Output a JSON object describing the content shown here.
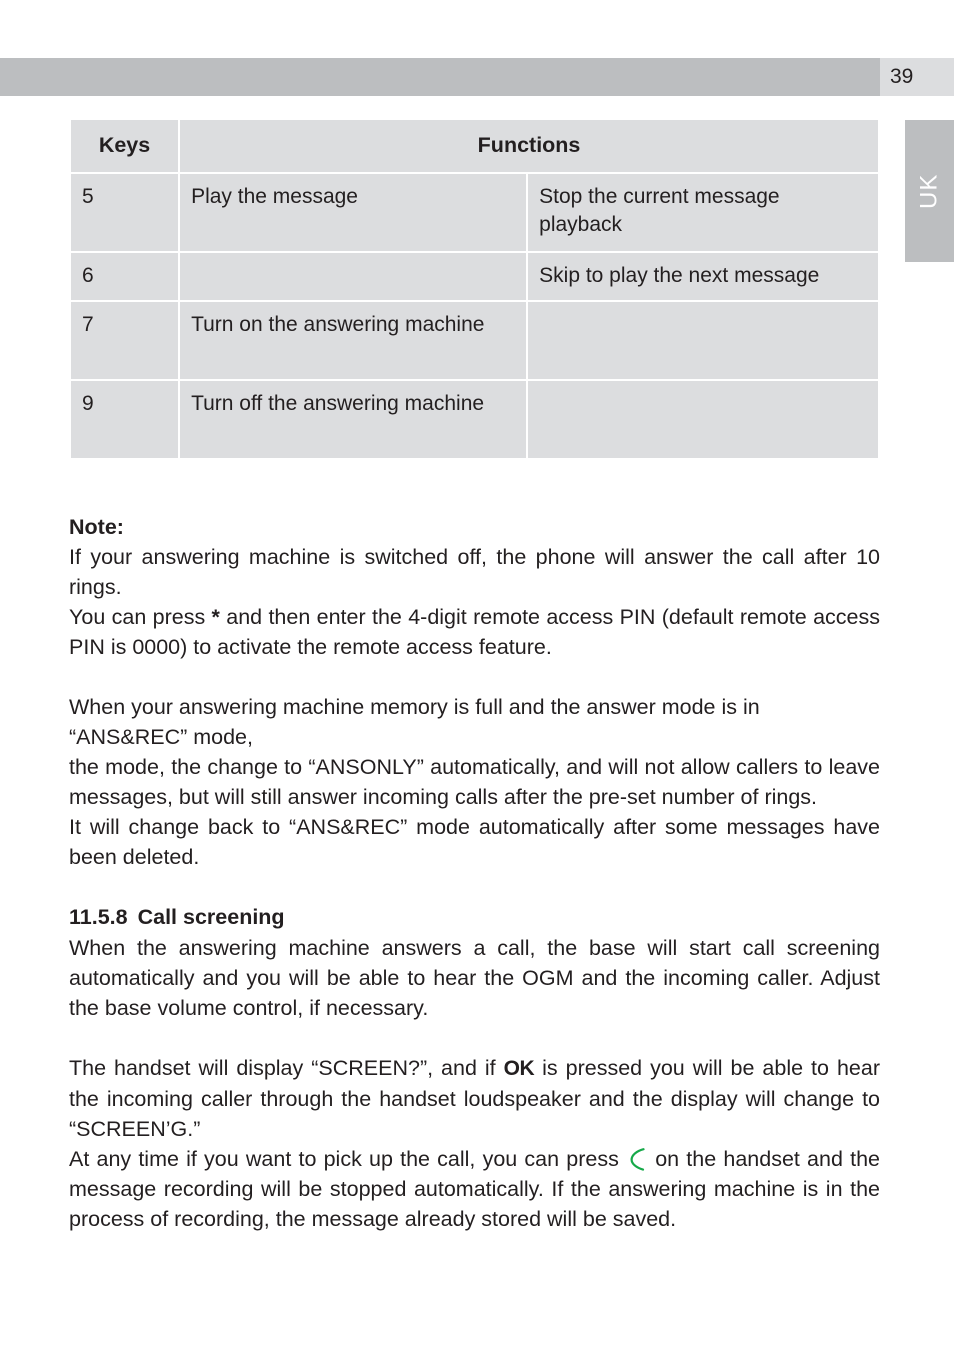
{
  "header": {
    "page_number": "39"
  },
  "side_tab": {
    "label": "UK"
  },
  "table": {
    "headers": {
      "keys": "Keys",
      "functions": "Functions"
    },
    "rows": [
      {
        "key": "5",
        "fn1": "Play the message",
        "fn2": "Stop the current message playback"
      },
      {
        "key": "6",
        "fn1": "",
        "fn2": "Skip to play the next message"
      },
      {
        "key": "7",
        "fn1": "Turn on the answering machine",
        "fn2": ""
      },
      {
        "key": "9",
        "fn1": "Turn off the answering machine",
        "fn2": ""
      }
    ]
  },
  "note": {
    "title": "Note:",
    "p1": "If your answering machine is switched off, the phone will answer the call after 10 rings.",
    "p2_part1": "You can press ",
    "p2_star": "*",
    "p2_part2": " and then enter the 4-digit remote access PIN (default remote access PIN is 0000) to activate the remote access feature.",
    "p3": "When your answering machine memory is full and the answer mode is in “ANS&REC” mode,",
    "p4": "the mode, the change to “ANSONLY” automatically, and will not allow callers to leave messages, but will still answer incoming calls after the pre-set number of rings.",
    "p5": "It will change back to “ANS&REC” mode automatically after some messages have been deleted."
  },
  "section": {
    "number": "11.5.8",
    "title": "Call screening",
    "p1": "When the answering machine answers a call, the base will start call screening automatically and you will be able to hear the OGM and the incoming caller. Adjust the base volume control, if necessary.",
    "p2_part1": "The handset will display “SCREEN?”, and if ",
    "p2_ok": "OK",
    "p2_part2": " is pressed you will be able to hear the incoming caller through the handset loudspeaker and the display will change to “SCREEN’G.”",
    "p3_part1": "At any time if you want to pick up the call, you can press ",
    "p3_icon": "phone-pickup-icon",
    "p3_part2": " on the handset and the message recording will be stopped automatically. If the answering machine is in the process of recording, the message already stored will be saved."
  },
  "colors": {
    "header_bar": "#bcbec0",
    "page_number_box": "#dcdddf",
    "table_cell": "#dcdddf",
    "text": "#231f20",
    "phone_green": "#17a94a"
  }
}
